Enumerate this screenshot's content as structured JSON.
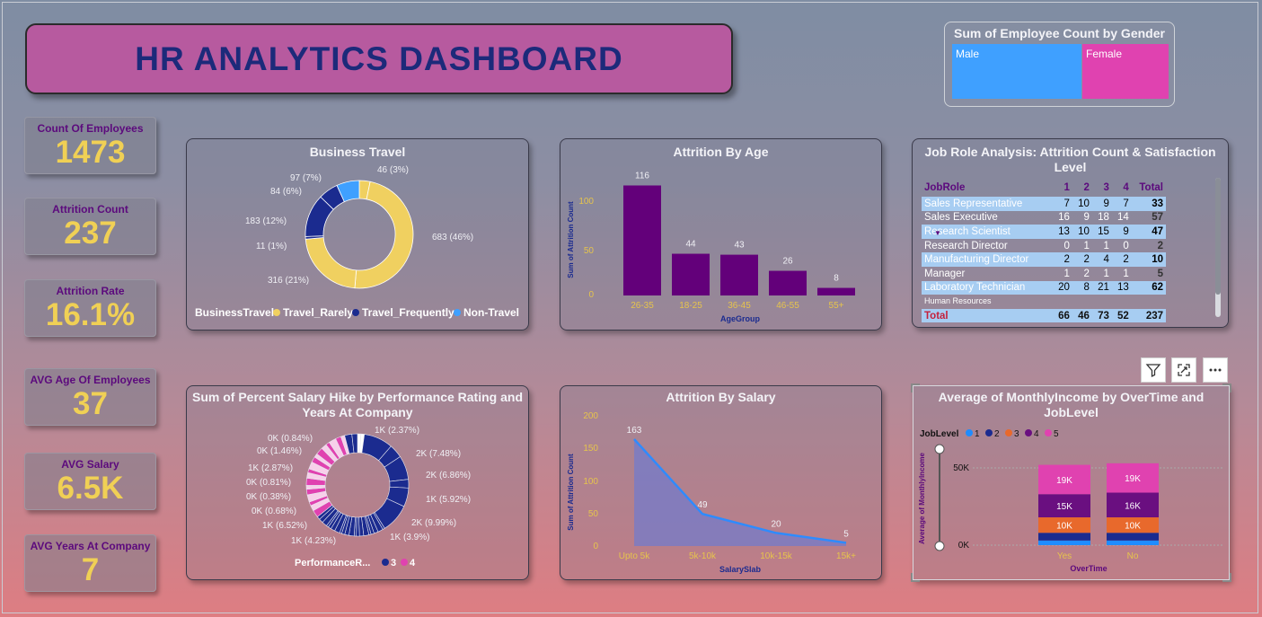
{
  "title": "HR ANALYTICS DASHBOARD",
  "kpis": [
    {
      "label": "Count Of Employees",
      "value": "1473"
    },
    {
      "label": "Attrition Count",
      "value": "237"
    },
    {
      "label": "Attrition Rate",
      "value": "16.1%"
    },
    {
      "label": "AVG Age Of Employees",
      "value": "37"
    },
    {
      "label": "AVG Salary",
      "value": "6.5K"
    },
    {
      "label": "AVG Years At Company",
      "value": "7"
    }
  ],
  "gender": {
    "title": "Sum of Employee Count by Gender",
    "male_label": "Male",
    "female_label": "Female",
    "male_color": "#3fa0ff",
    "female_color": "#e042b0"
  },
  "business_travel": {
    "title": "Business Travel",
    "legend_title": "BusinessTravel",
    "legend": [
      "Travel_Rarely",
      "Travel_Frequently",
      "Non-Travel"
    ],
    "labels": [
      "46 (3%)",
      "683 (46%)",
      "316 (21%)",
      "11 (1%)",
      "183 (12%)",
      "84 (6%)",
      "97 (7%)"
    ]
  },
  "attrition_age": {
    "title": "Attrition By Age",
    "ylabel": "Sum of Attrition Count",
    "xlabel": "AgeGroup",
    "yticks": [
      "0",
      "50",
      "100"
    ]
  },
  "job_role": {
    "title_line1": "Job Role Analysis: Attrition Count & Satisfaction",
    "title_line2": "Level",
    "header": [
      "JobRole",
      "1",
      "2",
      "3",
      "4",
      "Total"
    ],
    "rows": [
      [
        "Sales Representative",
        "7",
        "10",
        "9",
        "7",
        "33"
      ],
      [
        "Sales Executive",
        "16",
        "9",
        "18",
        "14",
        "57"
      ],
      [
        "Research Scientist",
        "13",
        "10",
        "15",
        "9",
        "47"
      ],
      [
        "Research Director",
        "0",
        "1",
        "1",
        "0",
        "2"
      ],
      [
        "Manufacturing Director",
        "2",
        "2",
        "4",
        "2",
        "10"
      ],
      [
        "Manager",
        "1",
        "2",
        "1",
        "1",
        "5"
      ],
      [
        "Laboratory Technician",
        "20",
        "8",
        "21",
        "13",
        "62"
      ],
      [
        "Human Resources",
        "",
        "",
        "",
        "",
        ""
      ]
    ],
    "total": [
      "Total",
      "66",
      "46",
      "73",
      "52",
      "237"
    ]
  },
  "salary_hike": {
    "title_line1": "Sum of Percent Salary Hike by Performance Rating and",
    "title_line2": "Years At Company",
    "legend_title": "PerformanceR...",
    "legend": [
      "3",
      "4"
    ],
    "labels_left": [
      "0K (0.84%)",
      "0K (1.46%)",
      "1K (2.87%)",
      "0K (0.81%)",
      "0K (0.38%)",
      "0K (0.68%)",
      "1K (6.52%)",
      "1K (4.23%)"
    ],
    "labels_right": [
      "1K (2.37%)",
      "2K (7.48%)",
      "2K (6.86%)",
      "1K (5.92%)",
      "2K (9.99%)",
      "1K (3.9%)"
    ]
  },
  "attrition_salary": {
    "title": "Attrition By Salary",
    "ylabel": "Sum of Attrition Count",
    "xlabel": "SalarySlab",
    "yticks": [
      "0",
      "50",
      "100",
      "150",
      "200"
    ]
  },
  "monthly_income": {
    "title_line1": "Average of MonthlyIncome by OverTime and",
    "title_line2": "JobLevel",
    "legend_title": "JobLevel",
    "legend": [
      "1",
      "2",
      "3",
      "4",
      "5"
    ],
    "legend_colors": [
      "#1f8cff",
      "#1b2b8f",
      "#e8692c",
      "#6a0f80",
      "#e042b0"
    ],
    "ylabel": "Average of MonthlyIncome",
    "xlabel": "OverTime",
    "yticks": [
      "0K",
      "50K"
    ],
    "categories": [
      "Yes",
      "No"
    ],
    "segment_labels": [
      [
        "10K",
        "15K",
        "19K"
      ],
      [
        "10K",
        "16K",
        "19K"
      ]
    ]
  },
  "chart_data": [
    {
      "type": "pie",
      "title": "Business Travel",
      "values": [
        46,
        683,
        316,
        11,
        183,
        84,
        97
      ],
      "labels": [
        "46 (3%)",
        "683 (46%)",
        "316 (21%)",
        "11 (1%)",
        "183 (12%)",
        "84 (6%)",
        "97 (7%)"
      ],
      "colors": [
        "#f0d060",
        "#f0d060",
        "#f0d060",
        "#1b2b8f",
        "#1b2b8f",
        "#1b2b8f",
        "#3fa0ff"
      ]
    },
    {
      "type": "bar",
      "title": "Attrition By Age",
      "categories": [
        "26-35",
        "18-25",
        "36-45",
        "46-55",
        "55+"
      ],
      "values": [
        116,
        44,
        43,
        26,
        8
      ],
      "xlabel": "AgeGroup",
      "ylabel": "Sum of Attrition Count",
      "ylim": [
        0,
        125
      ],
      "color": "#63007a"
    },
    {
      "type": "area",
      "title": "Attrition By Salary",
      "categories": [
        "Upto 5k",
        "5k-10k",
        "10k-15k",
        "15k+"
      ],
      "values": [
        163,
        49,
        20,
        5
      ],
      "xlabel": "SalarySlab",
      "ylabel": "Sum of Attrition Count",
      "ylim": [
        0,
        200
      ],
      "color": "#2e8bff"
    },
    {
      "type": "bar",
      "title": "Average of MonthlyIncome by OverTime and JobLevel",
      "categories": [
        "Yes",
        "No"
      ],
      "series": [
        {
          "name": "1",
          "values": [
            3,
            3
          ]
        },
        {
          "name": "2",
          "values": [
            5,
            5
          ]
        },
        {
          "name": "3",
          "values": [
            10,
            10
          ]
        },
        {
          "name": "4",
          "values": [
            15,
            16
          ]
        },
        {
          "name": "5",
          "values": [
            19,
            19
          ]
        }
      ],
      "xlabel": "OverTime",
      "ylabel": "Average of MonthlyIncome",
      "ylim": [
        0,
        55
      ]
    }
  ]
}
